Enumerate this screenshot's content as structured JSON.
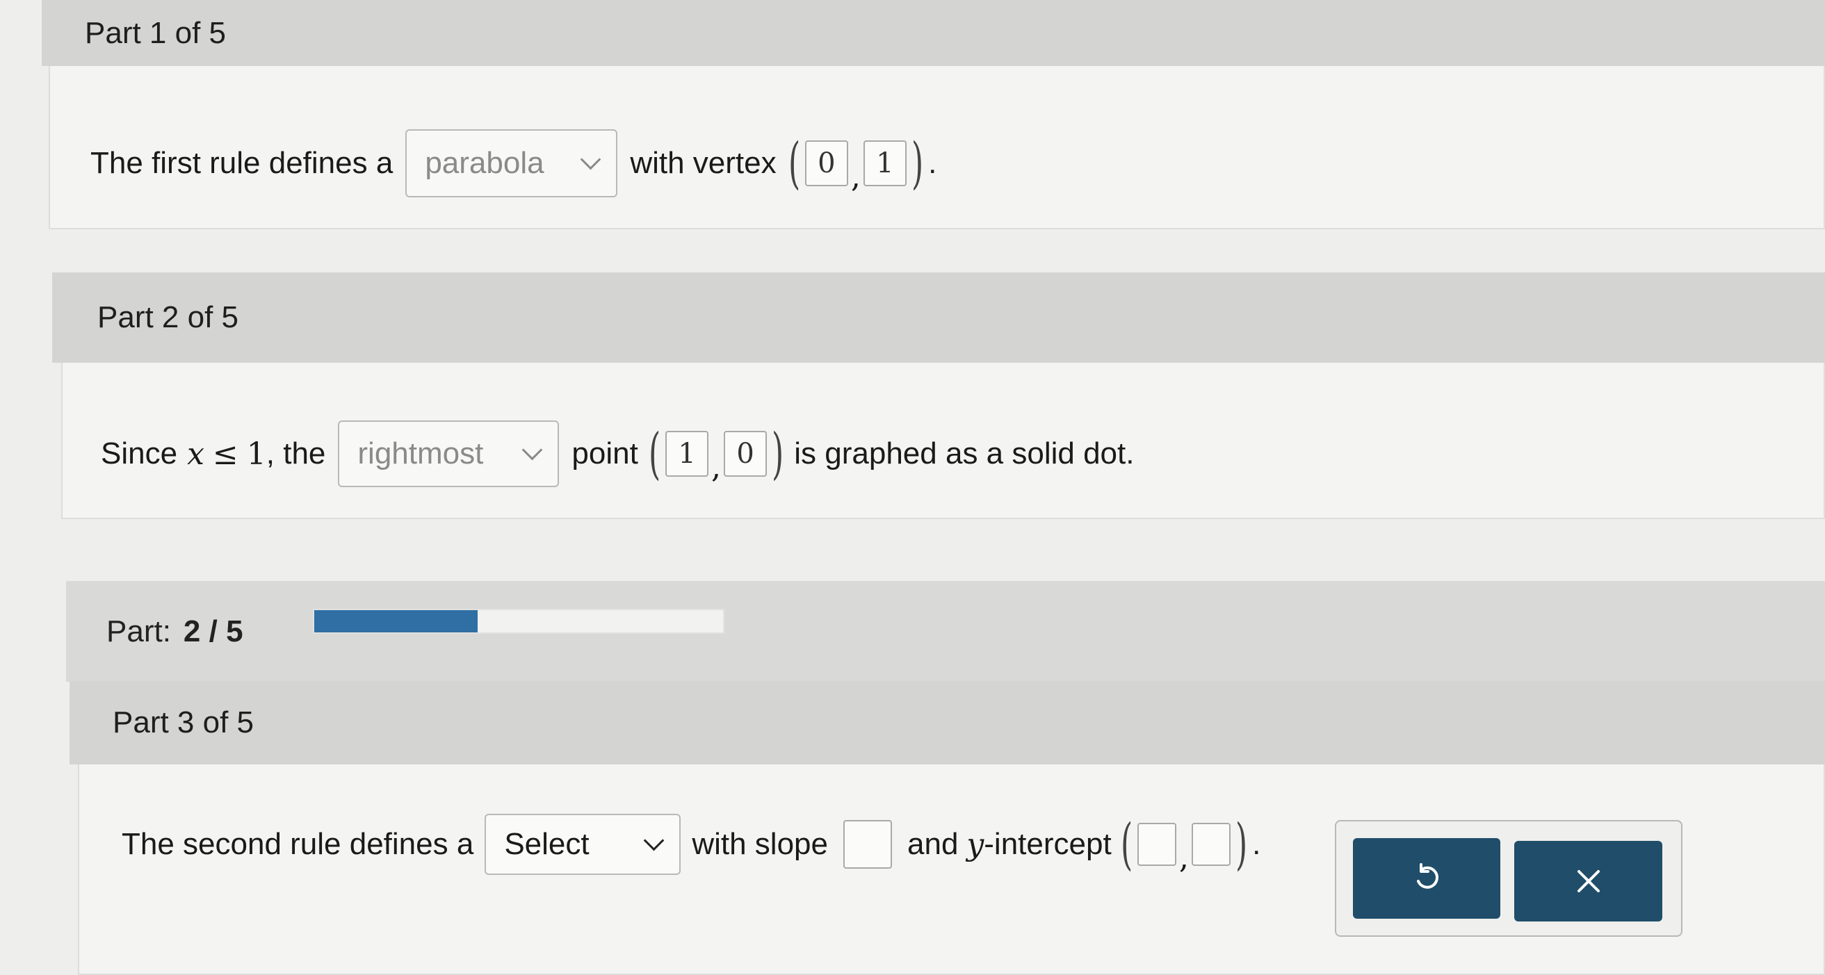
{
  "part1": {
    "header": "Part 1 of 5",
    "sentence_start": "The first rule defines a",
    "dropdown_value": "parabola",
    "after_dropdown": "with vertex",
    "vertex": [
      "0",
      "1"
    ],
    "end": "."
  },
  "part2": {
    "header": "Part 2 of 5",
    "since": "Since",
    "var": "x",
    "leq": "≤",
    "num": "1",
    "comma_the": ", the",
    "dropdown_value": "rightmost",
    "after_dropdown": "point",
    "point": [
      "1",
      "0"
    ],
    "end": "is graphed as a solid dot."
  },
  "progress": {
    "label": "Part:",
    "value": "2 / 5",
    "fraction": 0.4,
    "fill_color": "#2f6fa3"
  },
  "part3": {
    "header": "Part 3 of 5",
    "sentence_start": "The second rule defines a",
    "dropdown_value": "Select",
    "after_dropdown": "with slope",
    "and_text": "and",
    "y_var": "y",
    "intercept_text": "-intercept",
    "slope_value": "",
    "intercept": [
      "",
      ""
    ],
    "end": "."
  },
  "actions": {
    "undo_icon": "undo-icon",
    "close_icon": "close-icon",
    "button_color": "#1f4d6a"
  }
}
